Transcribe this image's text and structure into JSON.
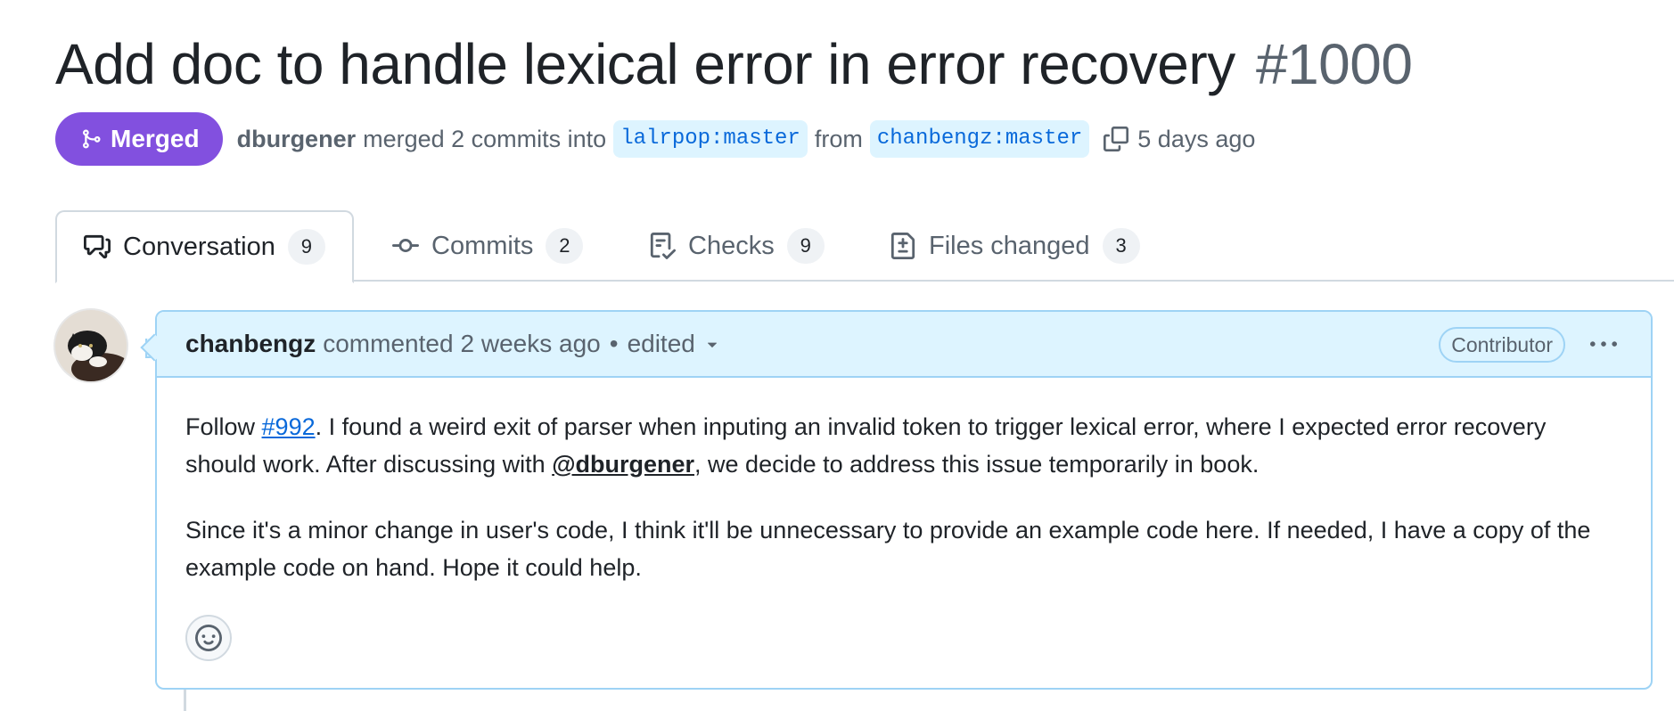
{
  "pr": {
    "title": "Add doc to handle lexical error in error recovery",
    "number": "#1000"
  },
  "meta": {
    "state_label": "Merged",
    "merged_by": "dburgener",
    "action_text": "merged 2 commits into",
    "base_branch": "lalrpop:master",
    "from_text": "from",
    "head_branch": "chanbengz:master",
    "time": "5 days ago"
  },
  "tabs": [
    {
      "label": "Conversation",
      "count": "9",
      "icon": "comment-discussion-icon"
    },
    {
      "label": "Commits",
      "count": "2",
      "icon": "git-commit-icon"
    },
    {
      "label": "Checks",
      "count": "9",
      "icon": "checklist-icon"
    },
    {
      "label": "Files changed",
      "count": "3",
      "icon": "file-diff-icon"
    }
  ],
  "comment": {
    "author": "chanbengz",
    "action": "commented",
    "time": "2 weeks ago",
    "dot": "•",
    "edited": "edited",
    "role": "Contributor",
    "p1_pre": "Follow ",
    "p1_link": "#992",
    "p1_mid": ". I found a weird exit of parser when inputing an invalid token to trigger lexical error, where I expected error recovery should work. After discussing with ",
    "p1_mention": "@dburgener",
    "p1_post": ", we decide to address this issue temporarily in book.",
    "p2": "Since it's a minor change in user's code, I think it'll be unnecessary to provide an example code here. If needed, I have a copy of the example code on hand. Hope it could help."
  },
  "colors": {
    "merged": "#8250df",
    "link": "#0969da",
    "header_bg": "#ddf4ff",
    "border_blue": "#9ed3f5"
  }
}
